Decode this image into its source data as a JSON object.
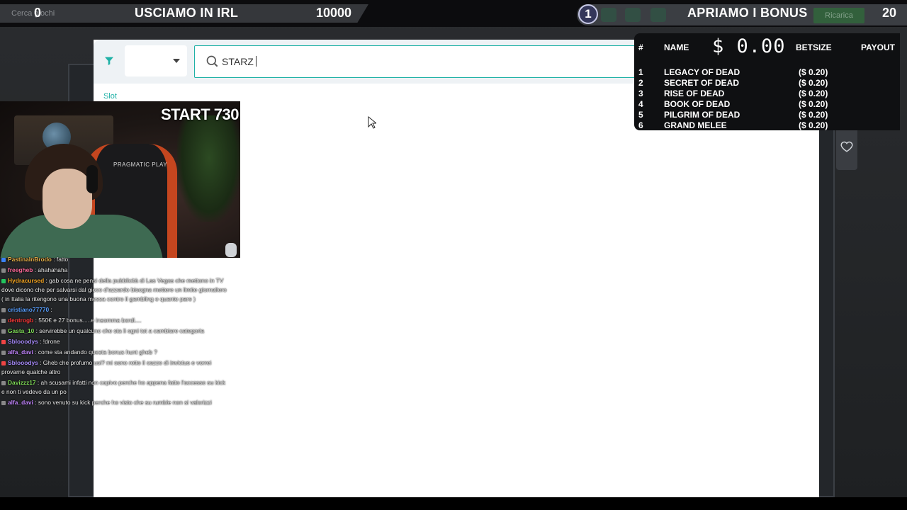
{
  "top_bar": {
    "left_counter": "0",
    "left_title": "USCIAMO IN IRL",
    "left_target": "10000",
    "browser_search_ghost": "Cerca giochi",
    "right_badge": "1",
    "right_title": "APRIAMO I BONUS",
    "right_counter": "20",
    "reload_button_ghost": "Ricarica"
  },
  "casino": {
    "search": {
      "value": "STARZ",
      "placeholder": ""
    },
    "category_label": "Slot",
    "colors": {
      "accent": "#1fb1a6"
    }
  },
  "webcam": {
    "overlay_text": "START 730",
    "chair_brand": "PRAGMATIC PLAY"
  },
  "chat": [
    {
      "user": "PastinaInBrodo",
      "text": ": fatto",
      "color": "#e6b24a",
      "dot": "#3b82f6",
      "faded": true
    },
    {
      "user": "freegheb",
      "text": ": ahahahaha",
      "color": "#ff6b9a",
      "dot": "#888888",
      "faded": false
    },
    {
      "user": "Hydracursed",
      "text": ": gab cosa ne pensi della pubblicità di Las Vegas che mettono in TV dove dicono che per salvarsi dal gioco d'azzardo bisogna mettere un limite giornaliero ( in Italia la ritengono una buona mossa contro il gambling e quanto pare )",
      "color": "#f5a623",
      "dot": "#22c55e",
      "faded": false
    },
    {
      "user": "cristiano77770",
      "text": ":",
      "color": "#5aa0ff",
      "dot": "#888888",
      "faded": false
    },
    {
      "user": "dentrogb",
      "text": ": 550€ e 27 bonus.....e insomma bordi....",
      "color": "#ff3b3b",
      "dot": "#888888",
      "faded": false
    },
    {
      "user": "Gasta_10",
      "text": ": servirebbe un qualcuno che sta li ogni tot a cambiare categoria",
      "color": "#7ed957",
      "dot": "#888888",
      "faded": false
    },
    {
      "user": "Sblooodys",
      "text": ": !drone",
      "color": "#a78bfa",
      "dot": "#ef4444",
      "faded": false
    },
    {
      "user": "alfa_davi",
      "text": ": come sta andando questa bonus hunt gheb ?",
      "color": "#c084fc",
      "dot": "#888888",
      "faded": false
    },
    {
      "user": "Sblooodys",
      "text": ": Gheb che profumo usi? mi sono rotto il cazzo di invictus e vorrei provarne qualche altro",
      "color": "#a78bfa",
      "dot": "#ef4444",
      "faded": false
    },
    {
      "user": "Davizzz17",
      "text": ": ah scusami infatti non capivo perche ho appena fatto l'accesso su kick e non ti vedevo da un po",
      "color": "#7ed957",
      "dot": "#888888",
      "faded": false
    },
    {
      "user": "alfa_davi",
      "text": ": sono venuto su kick perche ho visto che su rumble non si valorizzi",
      "color": "#c084fc",
      "dot": "#888888",
      "faded": false
    }
  ],
  "bonus_table": {
    "header": {
      "num": "#",
      "name": "NAME",
      "total": "$ 0.00",
      "betsize": "BETSIZE",
      "payout": "PAYOUT"
    },
    "rows": [
      {
        "num": "1",
        "name": "LEGACY OF DEAD",
        "bet": "($ 0.20)"
      },
      {
        "num": "2",
        "name": "SECRET OF DEAD",
        "bet": "($ 0.20)"
      },
      {
        "num": "3",
        "name": "RISE OF DEAD",
        "bet": "($ 0.20)"
      },
      {
        "num": "4",
        "name": "BOOK OF DEAD",
        "bet": "($ 0.20)"
      },
      {
        "num": "5",
        "name": "PILGRIM OF DEAD",
        "bet": "($ 0.20)"
      },
      {
        "num": "6",
        "name": "GRAND MELEE",
        "bet": "($ 0.20)"
      }
    ]
  }
}
